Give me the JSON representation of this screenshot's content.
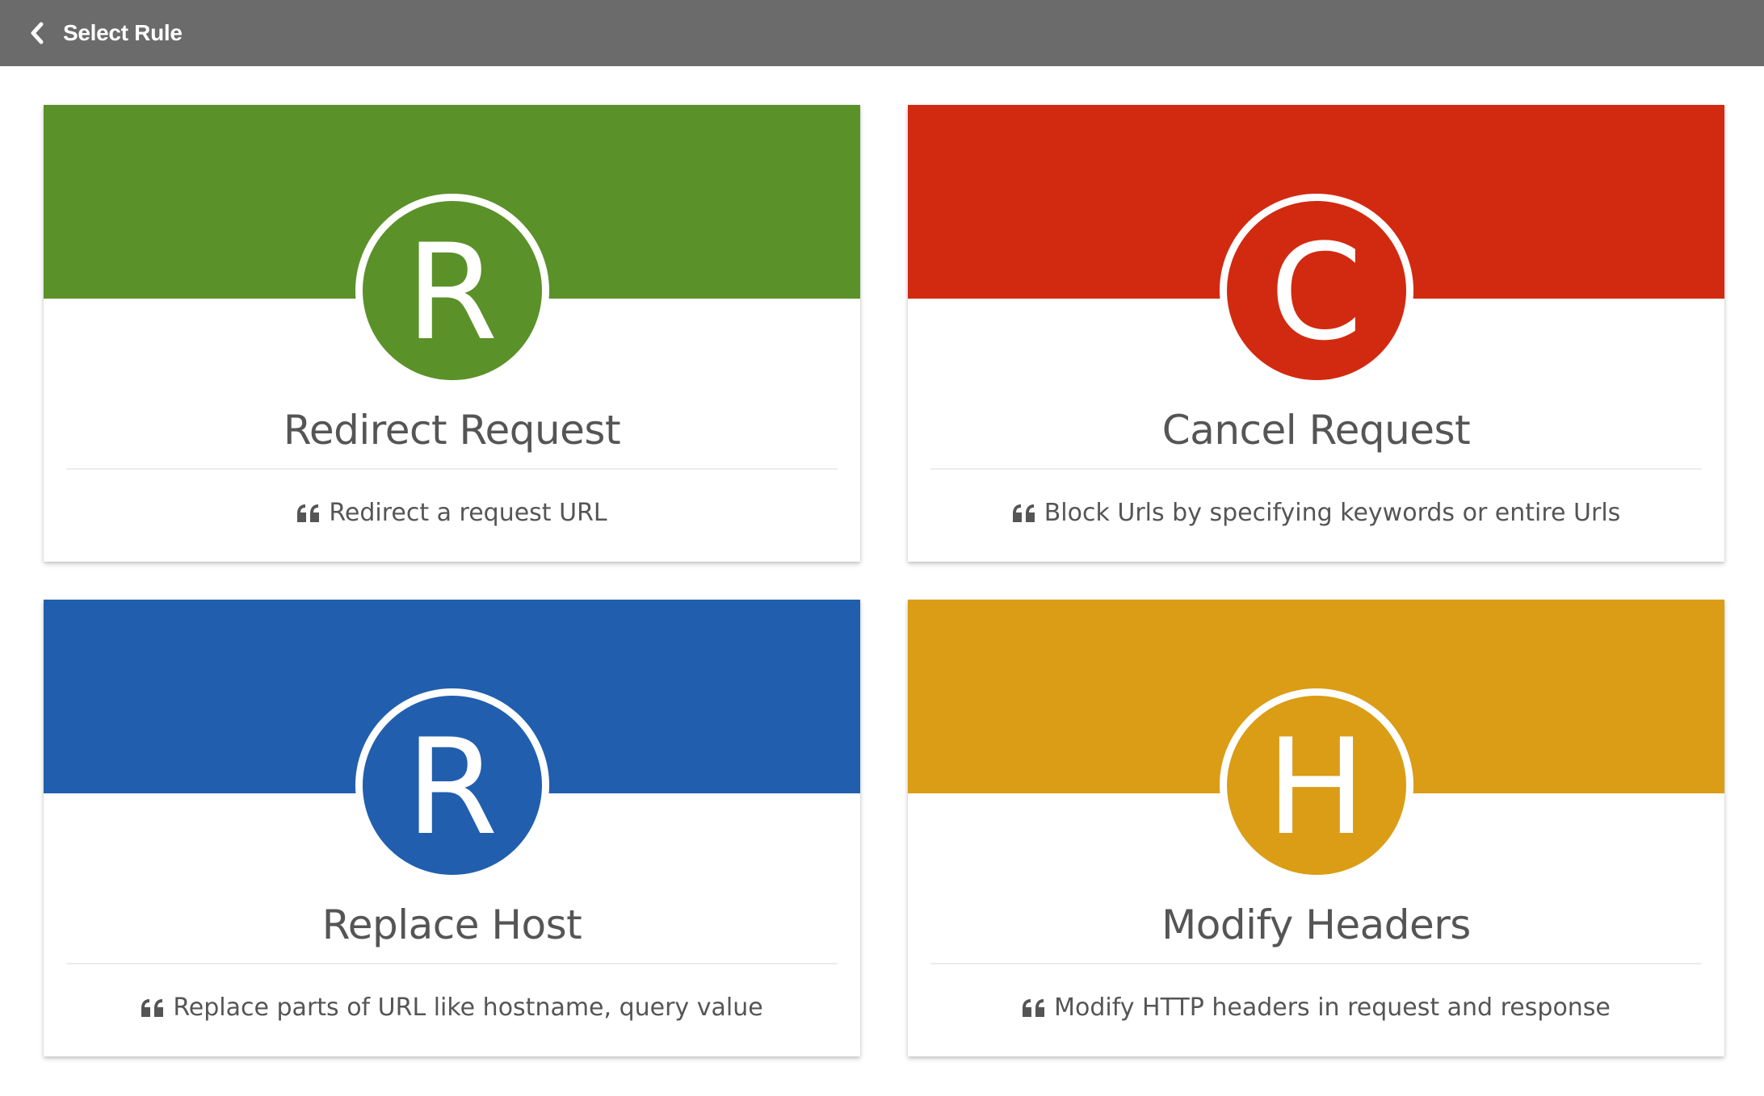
{
  "header": {
    "title": "Select Rule",
    "back_icon": "chevron-left-icon"
  },
  "colors": {
    "header_bg": "#6b6b6b",
    "redirect": "#5b9129",
    "cancel": "#d22a10",
    "replace": "#215fae",
    "headers": "#da9d15"
  },
  "rules": [
    {
      "letter": "R",
      "title": "Redirect Request",
      "description": "Redirect a request URL",
      "icon": "quote-icon"
    },
    {
      "letter": "C",
      "title": "Cancel Request",
      "description": "Block Urls by specifying keywords or entire Urls",
      "icon": "quote-icon"
    },
    {
      "letter": "R",
      "title": "Replace Host",
      "description": "Replace parts of URL like hostname, query value",
      "icon": "quote-icon"
    },
    {
      "letter": "H",
      "title": "Modify Headers",
      "description": "Modify HTTP headers in request and response",
      "icon": "quote-icon"
    }
  ]
}
